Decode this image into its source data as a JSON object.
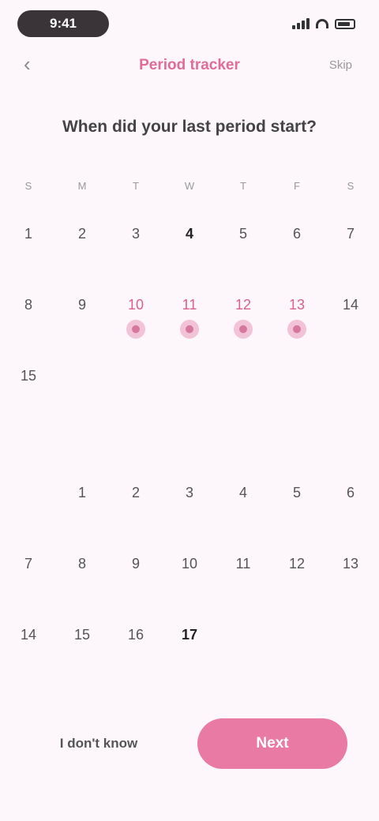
{
  "status_bar": {
    "time": "9:41"
  },
  "header": {
    "back_icon": "back-arrow-icon",
    "title": "Period tracker",
    "action": "Skip"
  },
  "question": "When did your last period start?",
  "weekdays": [
    "S",
    "M",
    "T",
    "W",
    "T",
    "F",
    "S"
  ],
  "calendar": {
    "months": [
      {
        "label": "",
        "weeks": [
          [
            {
              "num": "1",
              "sub": ""
            },
            {
              "num": "2",
              "sub": ""
            },
            {
              "num": "3",
              "sub": ""
            },
            {
              "num": "4",
              "sub": "",
              "today": true
            },
            {
              "num": "5",
              "sub": ""
            },
            {
              "num": "6",
              "sub": ""
            },
            {
              "num": "7",
              "sub": ""
            }
          ],
          [
            {
              "num": "8",
              "sub": ""
            },
            {
              "num": "9",
              "sub": ""
            },
            {
              "num": "10",
              "period": true
            },
            {
              "num": "11",
              "period": true
            },
            {
              "num": "12",
              "period": true
            },
            {
              "num": "13",
              "period": true
            },
            {
              "num": "14",
              "sub": ""
            }
          ],
          [
            {
              "num": "15",
              "sub": ""
            },
            {
              "empty": true
            },
            {
              "empty": true
            },
            {
              "empty": true
            },
            {
              "empty": true
            },
            {
              "empty": true
            },
            {
              "empty": true
            }
          ]
        ]
      },
      {
        "label": "",
        "weeks": [
          [
            {
              "empty": true
            },
            {
              "num": "1",
              "sub": ""
            },
            {
              "num": "2",
              "sub": ""
            },
            {
              "num": "3",
              "sub": ""
            },
            {
              "num": "4",
              "sub": ""
            },
            {
              "num": "5",
              "sub": ""
            },
            {
              "num": "6",
              "sub": ""
            }
          ],
          [
            {
              "num": "7",
              "sub": ""
            },
            {
              "num": "8",
              "sub": ""
            },
            {
              "num": "9",
              "sub": ""
            },
            {
              "num": "10",
              "sub": ""
            },
            {
              "num": "11",
              "sub": ""
            },
            {
              "num": "12",
              "sub": ""
            },
            {
              "num": "13",
              "sub": ""
            }
          ],
          [
            {
              "num": "14",
              "sub": ""
            },
            {
              "num": "15",
              "sub": ""
            },
            {
              "num": "16",
              "sub": ""
            },
            {
              "num": "17",
              "sub": "",
              "today": true
            },
            {
              "empty": true
            },
            {
              "empty": true
            },
            {
              "empty": true
            }
          ]
        ]
      }
    ]
  },
  "actions": {
    "secondary": "I don't know",
    "primary": "Next"
  },
  "colors": {
    "accent": "#e87aa3",
    "period": "#d6789e",
    "background": "#fdf7fb"
  }
}
